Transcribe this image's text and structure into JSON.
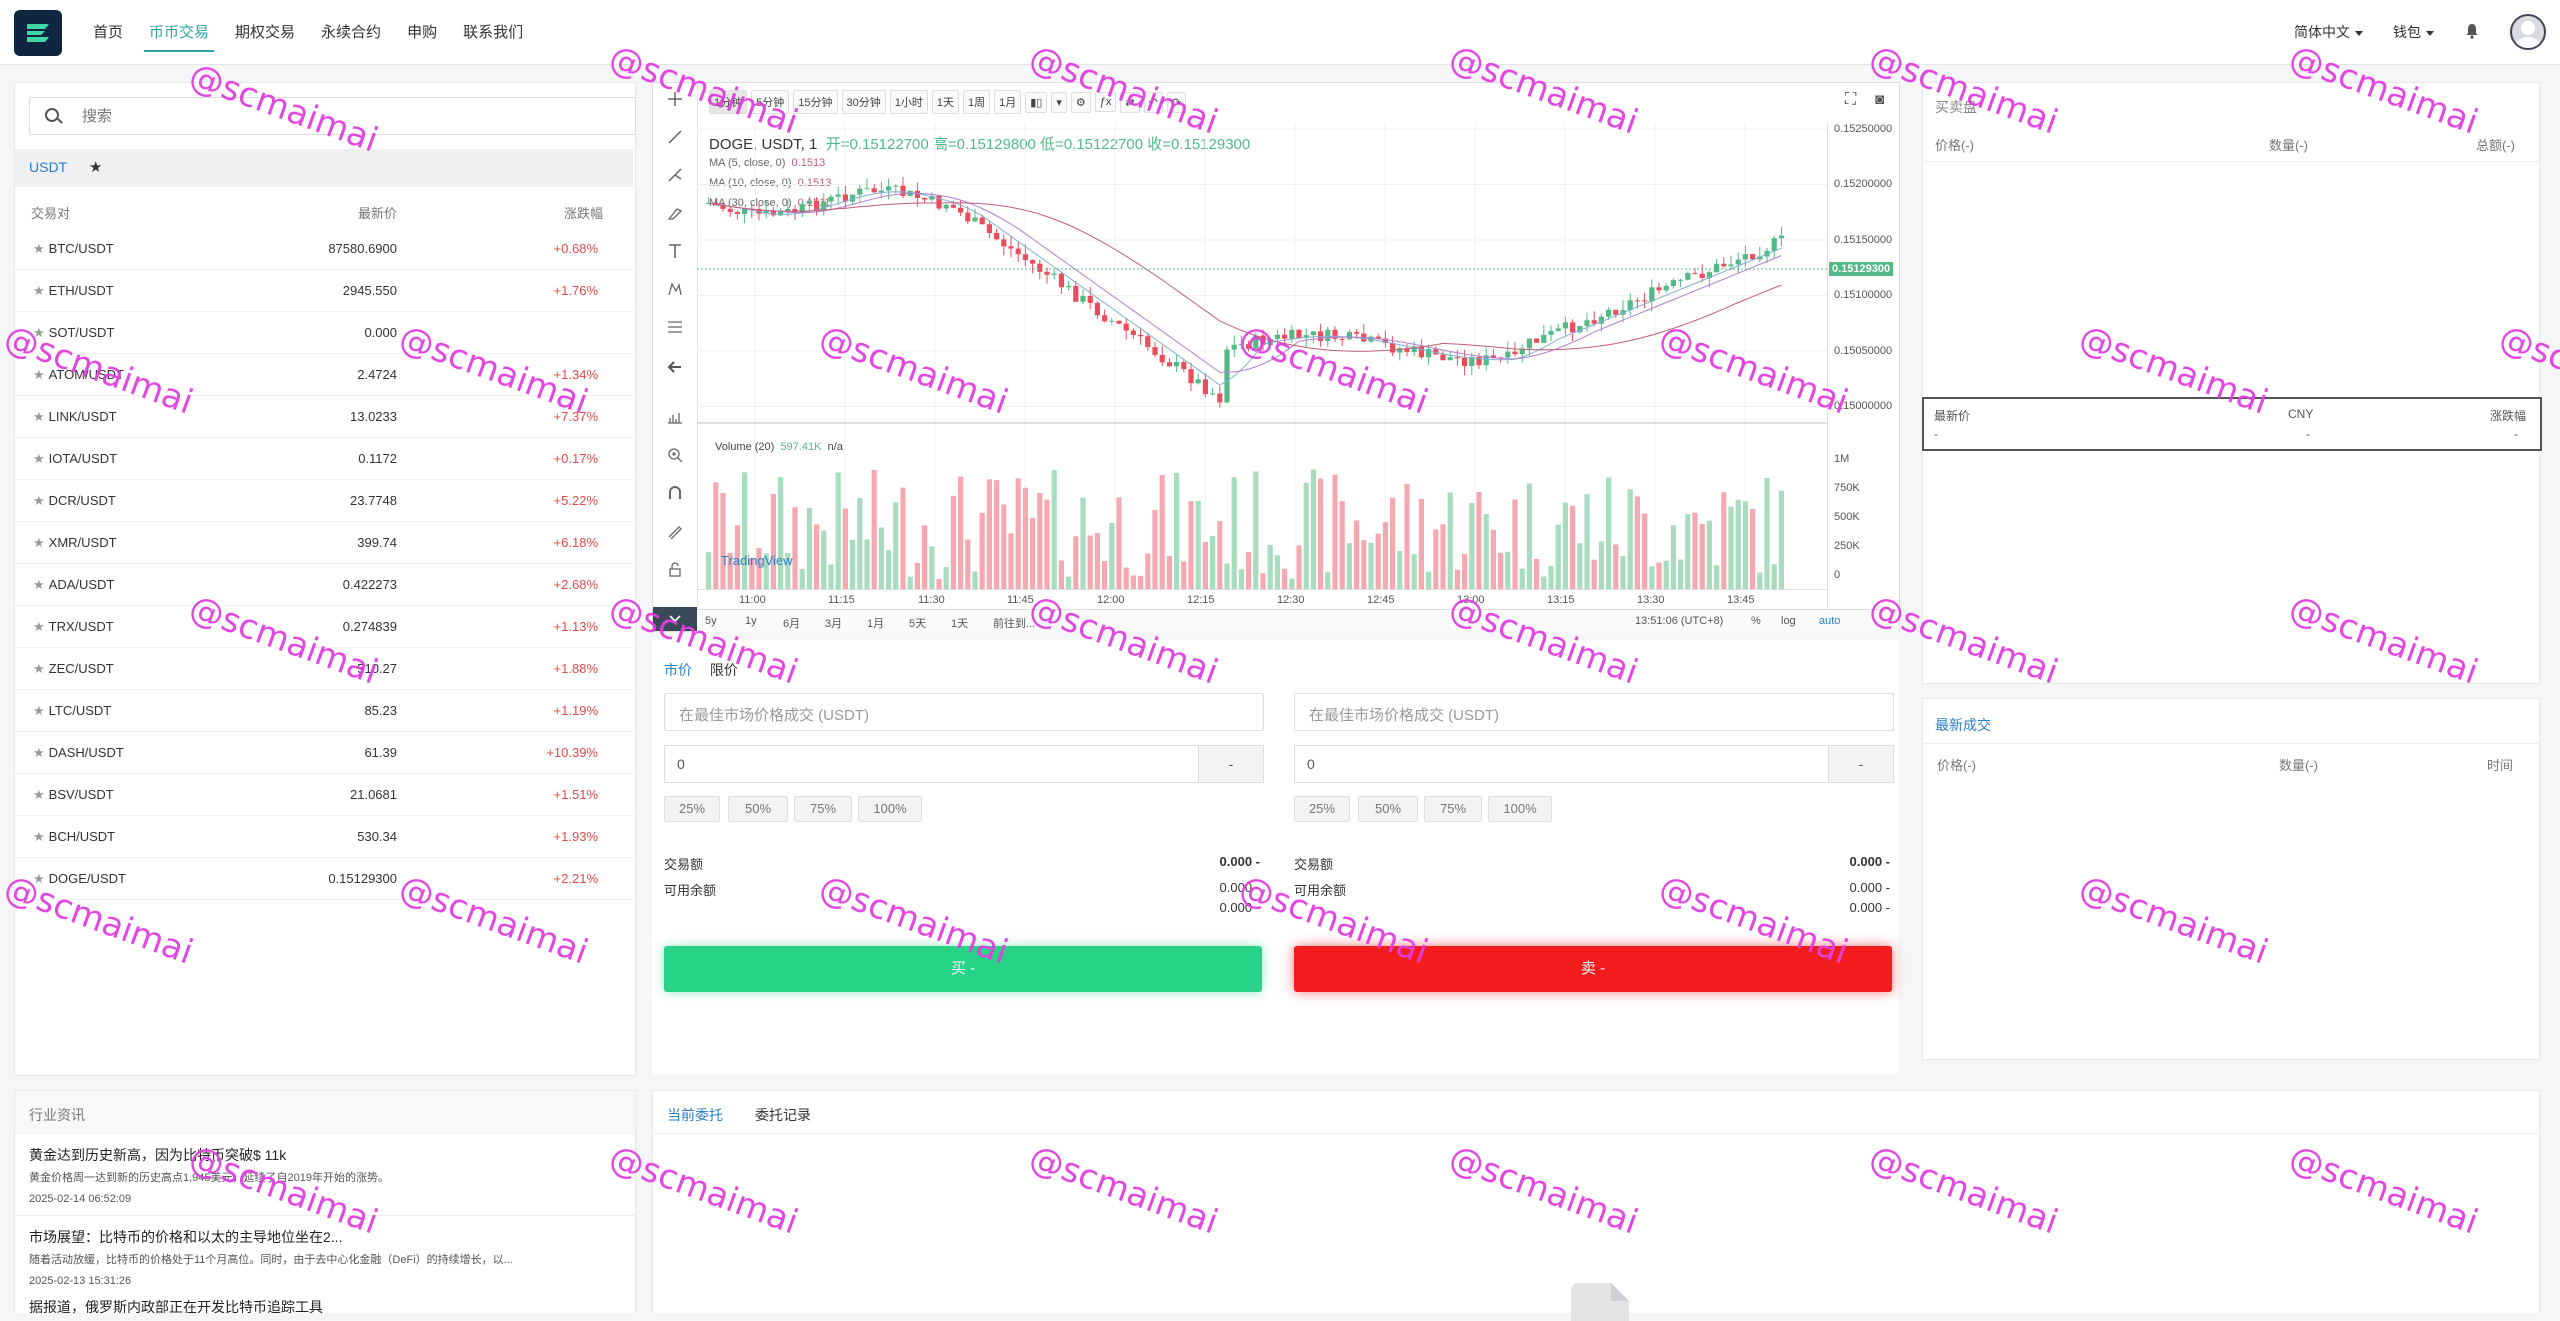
{
  "nav": {
    "items": [
      "首页",
      "币币交易",
      "期权交易",
      "永续合约",
      "申购",
      "联系我们"
    ],
    "active_index": 1,
    "language": "简体中文",
    "wallet": "钱包"
  },
  "market": {
    "search_placeholder": "搜索",
    "tabs": [
      "USDT",
      "★"
    ],
    "headers": [
      "交易对",
      "最新价",
      "涨跌幅"
    ],
    "rows": [
      {
        "pair": "BTC/USDT",
        "price": "87580.6900",
        "change": "+0.68%"
      },
      {
        "pair": "ETH/USDT",
        "price": "2945.550",
        "change": "+1.76%"
      },
      {
        "pair": "SOT/USDT",
        "price": "0.000",
        "change": ""
      },
      {
        "pair": "ATOM/USDT",
        "price": "2.4724",
        "change": "+1.34%"
      },
      {
        "pair": "LINK/USDT",
        "price": "13.0233",
        "change": "+7.37%"
      },
      {
        "pair": "IOTA/USDT",
        "price": "0.1172",
        "change": "+0.17%"
      },
      {
        "pair": "DCR/USDT",
        "price": "23.7748",
        "change": "+5.22%"
      },
      {
        "pair": "XMR/USDT",
        "price": "399.74",
        "change": "+6.18%"
      },
      {
        "pair": "ADA/USDT",
        "price": "0.422273",
        "change": "+2.68%"
      },
      {
        "pair": "TRX/USDT",
        "price": "0.274839",
        "change": "+1.13%"
      },
      {
        "pair": "ZEC/USDT",
        "price": "510.27",
        "change": "+1.88%"
      },
      {
        "pair": "LTC/USDT",
        "price": "85.23",
        "change": "+1.19%"
      },
      {
        "pair": "DASH/USDT",
        "price": "61.39",
        "change": "+10.39%"
      },
      {
        "pair": "BSV/USDT",
        "price": "21.0681",
        "change": "+1.51%"
      },
      {
        "pair": "BCH/USDT",
        "price": "530.34",
        "change": "+1.93%"
      },
      {
        "pair": "DOGE/USDT",
        "price": "0.15129300",
        "change": "+2.21%"
      }
    ]
  },
  "chart": {
    "intervals": [
      "1分钟",
      "5分钟",
      "15分钟",
      "30分钟",
      "1小时",
      "1天",
      "1周",
      "1月"
    ],
    "symbol": "DOGE, USDT, 1",
    "ohlc": "开=0.15122700  高=0.15129800  低=0.15122700  收=0.15129300",
    "ma": [
      {
        "label": "MA (5, close, 0)",
        "value": "0.1513"
      },
      {
        "label": "MA (10, close, 0)",
        "value": "0.1513"
      },
      {
        "label": "MA (30, close, 0)",
        "value": "0.1511"
      }
    ],
    "price_ticks": [
      "0.15250000",
      "0.15200000",
      "0.15150000",
      "0.15100000",
      "0.15050000",
      "0.15000000"
    ],
    "current_price": "0.15129300",
    "volume_label": "Volume (20)",
    "volume_value": "597.41K",
    "volume_na": "n/a",
    "volume_ticks": [
      "1M",
      "750K",
      "500K",
      "250K",
      "0"
    ],
    "time_ticks": [
      "11:00",
      "11:15",
      "11:30",
      "11:45",
      "12:00",
      "12:15",
      "12:30",
      "12:45",
      "13:00",
      "13:15",
      "13:30",
      "13:45"
    ],
    "ranges": [
      "5y",
      "1y",
      "6月",
      "3月",
      "1月",
      "5天",
      "1天",
      "前往到..."
    ],
    "clock": "13:51:06 (UTC+8)",
    "scale_opts": [
      "%",
      "log",
      "auto"
    ],
    "tv_logo": "TradingView"
  },
  "trade": {
    "tabs": [
      "市价",
      "限价"
    ],
    "buy": {
      "price_placeholder": "在最佳市场价格成交 (USDT)",
      "qty": "0",
      "minus": "-",
      "pcts": [
        "25%",
        "50%",
        "75%",
        "100%"
      ],
      "amount_label": "交易额",
      "amount_value": "0.000 -",
      "avail_label": "可用余额",
      "avail_1": "0.000 -",
      "avail_2": "0.000 -",
      "button": "买 -"
    },
    "sell": {
      "price_placeholder": "在最佳市场价格成交 (USDT)",
      "qty": "0",
      "minus": "-",
      "pcts": [
        "25%",
        "50%",
        "75%",
        "100%"
      ],
      "amount_label": "交易额",
      "amount_value": "0.000 -",
      "avail_label": "可用余额",
      "avail_1": "0.000 -",
      "avail_2": "0.000 -",
      "button": "卖 -"
    }
  },
  "orderbook": {
    "title": "买卖盘",
    "headers": [
      "价格(-)",
      "数量(-)",
      "总额(-)"
    ],
    "last_headers": [
      "最新价",
      "CNY",
      "涨跌幅"
    ],
    "last_values": [
      "-",
      "-",
      "-"
    ]
  },
  "trades": {
    "title": "最新成交",
    "headers": [
      "价格(-)",
      "数量(-)",
      "时间"
    ]
  },
  "news": {
    "title": "行业资讯",
    "items": [
      {
        "title": "黄金达到历史新高，因为比特币突破$ 11k",
        "body": "黄金价格周一达到新的历史高点1,945美元，延续了自2019年开始的涨势。",
        "date": "2025-02-14 06:52:09"
      },
      {
        "title": "市场展望：比特币的价格和以太的主导地位坐在2...",
        "body": "随着活动放缓，比特币的价格处于11个月高位。同时，由于去中心化金融（DeFi）的持续增长，以...",
        "date": "2025-02-13 15:31:26"
      },
      {
        "title": "据报道，俄罗斯内政部正在开发比特币追踪工具",
        "body": "",
        "date": ""
      }
    ]
  },
  "orders": {
    "tabs": [
      "当前委托",
      "委托记录"
    ]
  },
  "watermark": "@scmaimai",
  "colors": {
    "accent": "#2fa3a3",
    "up": "#53b987",
    "down": "#eb4d5c",
    "buy": "#28d388",
    "sell": "#f31c1c",
    "watermark": "#e23ee0"
  }
}
